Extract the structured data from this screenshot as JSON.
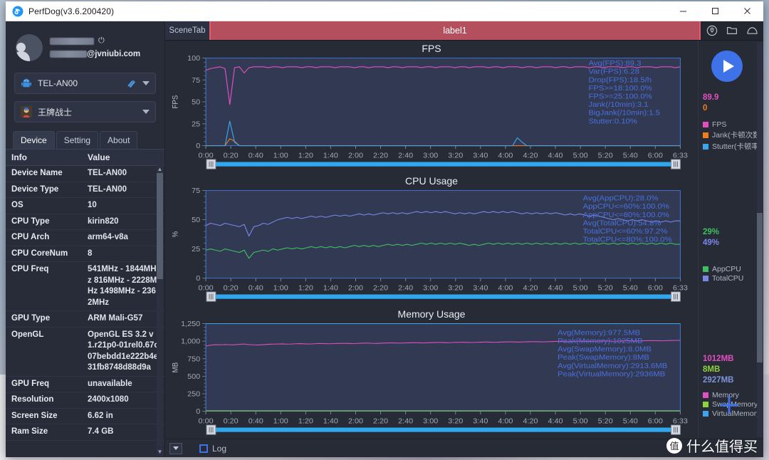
{
  "window": {
    "title": "PerfDog(v3.6.200420)",
    "logo_icon": "perfdog-logo-icon",
    "controls": [
      {
        "name": "minimize-button",
        "icon": "minimize-icon"
      },
      {
        "name": "maximize-button",
        "icon": "maximize-icon"
      },
      {
        "name": "close-button",
        "icon": "close-icon"
      }
    ]
  },
  "sidebar": {
    "account": {
      "name_redacted": true,
      "email": "@jvniubi.com",
      "power_icon": "power-icon",
      "avatar_icon": "avatar-icon"
    },
    "device_select": {
      "value": "TEL-AN00",
      "platform_icon": "android-icon",
      "usb_icon": "usb-link-icon",
      "caret_icon": "chevron-down-icon"
    },
    "app_select": {
      "value": "王牌战士",
      "app_icon": "game-app-icon",
      "caret_icon": "chevron-down-icon"
    },
    "tabs": [
      {
        "label": "Device",
        "active": true
      },
      {
        "label": "Setting",
        "active": false
      },
      {
        "label": "About",
        "active": false
      }
    ],
    "table": {
      "headers": [
        "Info",
        "Value"
      ],
      "rows": [
        [
          "Device Name",
          "TEL-AN00"
        ],
        [
          "Device Type",
          "TEL-AN00"
        ],
        [
          "OS",
          "10"
        ],
        [
          "CPU Type",
          "kirin820"
        ],
        [
          "CPU Arch",
          "arm64-v8a"
        ],
        [
          "CPU CoreNum",
          "8"
        ],
        [
          "CPU Freq",
          "541MHz - 1844MHz 816MHz - 2228MHz 1498MHz - 2362MHz"
        ],
        [
          "GPU Type",
          "ARM Mali-G57"
        ],
        [
          "OpenGL",
          "OpenGL ES 3.2 v1.r21p0-01rel0.67c07bebdd1e222b4e31fb8748d88d9a"
        ],
        [
          "GPU Freq",
          "unavailable"
        ],
        [
          "Resolution",
          "2400x1080"
        ],
        [
          "Screen Size",
          "6.62 in"
        ],
        [
          "Ram Size",
          "7.4 GB"
        ]
      ]
    }
  },
  "scene_bar": {
    "tab_label": "SceneTab",
    "label_strip": "label1",
    "icons": [
      {
        "name": "location-pin-icon"
      },
      {
        "name": "folder-icon"
      },
      {
        "name": "cloud-icon"
      }
    ]
  },
  "toolbar": {
    "play_button": "play-icon",
    "add_button": "plus-icon"
  },
  "bottom": {
    "collapse_icon": "chevron-down-icon",
    "log_label": "Log",
    "log_checked": false
  },
  "watermark": {
    "badge": "值",
    "text": "什么值得买"
  },
  "colors": {
    "fps": "#e24fc0",
    "jank": "#ef7d1a",
    "stutter": "#3da5f0",
    "appcpu": "#3fbf5f",
    "totalcpu": "#7a86e8",
    "memory": "#e24fc0",
    "swapmemory": "#8fd13f",
    "virtualmemory": "#3da5f0",
    "stat_text": "#4b6fe0",
    "accent": "#3d72e8",
    "scene_strip": "#b4505e"
  },
  "chart_data": [
    {
      "type": "line",
      "title": "FPS",
      "ylabel": "FPS",
      "xlabel": "",
      "ylim": [
        0,
        100
      ],
      "yticks": [
        0,
        25,
        50,
        75,
        100
      ],
      "xticks": [
        "0:00",
        "0:20",
        "0:40",
        "1:00",
        "1:20",
        "1:40",
        "2:00",
        "2:20",
        "2:40",
        "3:00",
        "3:20",
        "3:40",
        "4:00",
        "4:20",
        "4:40",
        "5:00",
        "5:20",
        "5:40",
        "6:00",
        "6:33"
      ],
      "grid": false,
      "legend_position": "right",
      "series": [
        {
          "name": "FPS",
          "color": "#e24fc0",
          "current": "89.9",
          "values": [
            86,
            88,
            89,
            90,
            88,
            47,
            89,
            90,
            83,
            89,
            90,
            90,
            90,
            89,
            90,
            90,
            89,
            90,
            90,
            90,
            89,
            90,
            90,
            89,
            90,
            90,
            90,
            89,
            90,
            90,
            90,
            89,
            90,
            90,
            89,
            90,
            90,
            90,
            89,
            90,
            90,
            89,
            90,
            90,
            90,
            89,
            90,
            90,
            89,
            90,
            90,
            90,
            89,
            90,
            90,
            89,
            90,
            90,
            90,
            89,
            90,
            90,
            89,
            90,
            90,
            90,
            89,
            90,
            90,
            89,
            90,
            90,
            90,
            89,
            90,
            90,
            89,
            90,
            90,
            90,
            89,
            90,
            90,
            89,
            90,
            90,
            90,
            89,
            90,
            90,
            89,
            90,
            90,
            90,
            89,
            90,
            90,
            90,
            89,
            90
          ]
        },
        {
          "name": "Jank(卡顿次数)",
          "color": "#ef7d1a",
          "current": "0",
          "values": [
            0,
            0,
            0,
            0,
            0,
            8,
            5,
            0,
            0,
            0,
            0,
            0,
            0,
            0,
            0,
            0,
            0,
            0,
            0,
            0,
            0,
            0,
            0,
            0,
            0,
            0,
            0,
            0,
            0,
            0,
            0,
            0,
            0,
            0,
            0,
            0,
            0,
            0,
            0,
            0,
            0,
            0,
            0,
            0,
            0,
            0,
            0,
            0,
            0,
            0,
            0,
            0,
            0,
            0,
            0,
            0,
            0,
            0,
            0,
            0,
            0,
            0,
            0,
            0,
            0,
            0,
            0,
            0,
            0,
            0,
            0,
            0,
            0,
            0,
            0,
            0,
            0,
            0,
            0,
            0,
            0,
            0,
            0,
            0,
            0,
            0,
            0,
            0,
            0,
            0,
            0,
            0,
            0,
            0,
            0,
            0,
            0,
            0,
            0,
            0
          ]
        },
        {
          "name": "Stutter(卡顿率)",
          "color": "#3da5f0",
          "current": "",
          "values": [
            0,
            0,
            0,
            0,
            0,
            28,
            4,
            0,
            0,
            0,
            0,
            0,
            0,
            0,
            0,
            0,
            0,
            0,
            0,
            0,
            0,
            0,
            0,
            0,
            0,
            0,
            0,
            0,
            0,
            0,
            0,
            0,
            0,
            0,
            0,
            0,
            0,
            0,
            0,
            0,
            0,
            0,
            0,
            0,
            0,
            0,
            0,
            0,
            0,
            0,
            0,
            0,
            0,
            0,
            0,
            0,
            0,
            0,
            0,
            0,
            0,
            0,
            0,
            0,
            0,
            9,
            4,
            0,
            0,
            0,
            0,
            0,
            0,
            0,
            0,
            0,
            0,
            0,
            0,
            0,
            0,
            0,
            0,
            0,
            0,
            0,
            0,
            0,
            0,
            0,
            0,
            0,
            0,
            0,
            0,
            0,
            0,
            0,
            0,
            0
          ]
        }
      ],
      "annotations": [
        "Avg(FPS):89.3",
        "Var(FPS):6.28",
        "Drop(FPS):18.5/h",
        "FPS>=18:100.0%",
        "FPS>=25:100.0%",
        "Jank(/10min):3.1",
        "BigJank(/10min):1.5",
        "Stutter:0.10%"
      ]
    },
    {
      "type": "line",
      "title": "CPU Usage",
      "ylabel": "%",
      "xlabel": "",
      "ylim": [
        0,
        75
      ],
      "yticks": [
        0,
        25,
        50,
        75
      ],
      "xticks": [
        "0:00",
        "0:20",
        "0:40",
        "1:00",
        "1:20",
        "1:40",
        "2:00",
        "2:20",
        "2:40",
        "3:00",
        "3:20",
        "3:40",
        "4:00",
        "4:20",
        "4:40",
        "5:00",
        "5:20",
        "5:40",
        "6:00",
        "6:33"
      ],
      "grid": false,
      "legend_position": "right",
      "series": [
        {
          "name": "AppCPU",
          "color": "#3fbf5f",
          "current": "29%",
          "values": [
            24,
            25,
            24,
            23,
            25,
            24,
            23,
            22,
            24,
            17,
            22,
            23,
            24,
            23,
            25,
            24,
            25,
            26,
            25,
            26,
            25,
            26,
            27,
            26,
            27,
            26,
            27,
            26,
            27,
            26,
            27,
            28,
            27,
            28,
            27,
            28,
            27,
            28,
            29,
            28,
            29,
            28,
            29,
            28,
            29,
            30,
            29,
            30,
            29,
            30,
            29,
            30,
            29,
            30,
            29,
            28,
            29,
            28,
            29,
            30,
            29,
            30,
            29,
            30,
            29,
            30,
            29,
            30,
            29,
            30,
            29,
            30,
            29,
            30,
            29,
            30,
            29,
            30,
            29,
            30,
            29,
            30,
            29,
            30,
            29,
            30,
            29,
            30,
            29,
            30,
            29,
            30,
            29,
            30,
            29,
            30,
            29,
            30,
            29,
            29
          ]
        },
        {
          "name": "TotalCPU",
          "color": "#7a86e8",
          "current": "49%",
          "values": [
            45,
            47,
            46,
            45,
            47,
            46,
            45,
            44,
            46,
            36,
            44,
            45,
            47,
            46,
            48,
            50,
            51,
            52,
            51,
            52,
            51,
            52,
            53,
            52,
            53,
            52,
            53,
            54,
            53,
            54,
            53,
            54,
            55,
            54,
            55,
            54,
            55,
            56,
            55,
            56,
            55,
            56,
            55,
            56,
            57,
            56,
            57,
            56,
            57,
            56,
            57,
            56,
            55,
            56,
            55,
            56,
            55,
            56,
            57,
            56,
            57,
            56,
            57,
            56,
            57,
            56,
            55,
            56,
            55,
            56,
            55,
            56,
            55,
            56,
            55,
            54,
            55,
            54,
            55,
            54,
            53,
            54,
            53,
            52,
            51,
            50,
            51,
            50,
            49,
            50,
            49,
            50,
            49,
            48,
            49,
            48,
            49,
            48,
            49,
            49
          ]
        }
      ],
      "annotations": [
        "Avg(AppCPU):28.0%",
        "AppCPU<=60%:100.0%",
        "AppCPU<=80%:100.0%",
        "Avg(TotalCPU):54.8%",
        "TotalCPU<=60%:97.2%",
        "TotalCPU<=80%:100.0%"
      ]
    },
    {
      "type": "line",
      "title": "Memory Usage",
      "ylabel": "MB",
      "xlabel": "",
      "ylim": [
        0,
        1250
      ],
      "yticks": [
        0,
        250,
        500,
        750,
        1000,
        1250
      ],
      "ytick_labels": [
        "0",
        "250",
        "500",
        "750",
        "1,000",
        "1,250"
      ],
      "xticks": [
        "0:00",
        "0:20",
        "0:40",
        "1:00",
        "1:20",
        "1:40",
        "2:00",
        "2:20",
        "2:40",
        "3:00",
        "3:20",
        "3:40",
        "4:00",
        "4:20",
        "4:40",
        "5:00",
        "5:20",
        "5:40",
        "6:00",
        "6:33"
      ],
      "grid": false,
      "legend_position": "right",
      "series": [
        {
          "name": "Memory",
          "color": "#e24fc0",
          "current": "1012MB",
          "values": [
            930,
            945,
            950,
            948,
            952,
            949,
            947,
            955,
            960,
            952,
            948,
            946,
            950,
            955,
            958,
            960,
            962,
            958,
            960,
            963,
            965,
            962,
            960,
            964,
            967,
            965,
            963,
            966,
            968,
            970,
            968,
            966,
            969,
            971,
            973,
            970,
            968,
            971,
            974,
            976,
            974,
            972,
            975,
            977,
            979,
            977,
            975,
            978,
            980,
            982,
            980,
            978,
            981,
            983,
            985,
            983,
            981,
            984,
            986,
            988,
            986,
            984,
            987,
            989,
            991,
            989,
            987,
            990,
            992,
            994,
            992,
            990,
            993,
            995,
            997,
            995,
            993,
            996,
            998,
            1000,
            998,
            996,
            999,
            1001,
            1003,
            1001,
            999,
            1002,
            1004,
            1006,
            1004,
            1002,
            1005,
            1007,
            1009,
            1007,
            1005,
            1008,
            1010,
            1012,
            1012
          ]
        },
        {
          "name": "SwapMemory",
          "color": "#8fd13f",
          "current": "8MB",
          "values": [
            8,
            8,
            8,
            8,
            8,
            8,
            8,
            8,
            8,
            8,
            8,
            8,
            8,
            8,
            8,
            8,
            8,
            8,
            8,
            8,
            8,
            8,
            8,
            8,
            8,
            8,
            8,
            8,
            8,
            8,
            8,
            8,
            8,
            8,
            8,
            8,
            8,
            8,
            8,
            8,
            8,
            8,
            8,
            8,
            8,
            8,
            8,
            8,
            8,
            8,
            8,
            8,
            8,
            8,
            8,
            8,
            8,
            8,
            8,
            8,
            8,
            8,
            8,
            8,
            8,
            8,
            8,
            8,
            8,
            8,
            8,
            8,
            8,
            8,
            8,
            8,
            8,
            8,
            8,
            8,
            8,
            8,
            8,
            8,
            8,
            8,
            8,
            8,
            8,
            8,
            8,
            8,
            8,
            8,
            8,
            8,
            8,
            8,
            8,
            8
          ]
        },
        {
          "name": "VirtualMemory",
          "color": "#3da5f0",
          "current": "2927MB",
          "values": [
            2870,
            2880,
            2885,
            2888,
            2890,
            2892,
            2893,
            2895,
            2896,
            2897,
            2898,
            2899,
            2900,
            2901,
            2902,
            2903,
            2904,
            2905,
            2906,
            2907,
            2908,
            2909,
            2910,
            2911,
            2912,
            2913,
            2913,
            2914,
            2914,
            2915,
            2915,
            2916,
            2916,
            2917,
            2917,
            2918,
            2918,
            2919,
            2919,
            2920,
            2920,
            2921,
            2921,
            2922,
            2922,
            2922,
            2923,
            2923,
            2923,
            2924,
            2924,
            2924,
            2925,
            2925,
            2925,
            2926,
            2926,
            2926,
            2926,
            2927,
            2927,
            2927,
            2927,
            2928,
            2928,
            2928,
            2928,
            2929,
            2929,
            2929,
            2929,
            2930,
            2930,
            2930,
            2930,
            2931,
            2931,
            2931,
            2931,
            2932,
            2932,
            2932,
            2932,
            2933,
            2933,
            2933,
            2933,
            2934,
            2934,
            2934,
            2934,
            2935,
            2935,
            2935,
            2935,
            2936,
            2936,
            2936,
            2927,
            2927
          ]
        }
      ],
      "annotations": [
        "Avg(Memory):977.5MB",
        "Peak(Memory):1025MB",
        "Avg(SwapMemory):8.0MB",
        "Peak(SwapMemory):8MB",
        "Avg(VirtualMemory):2913.6MB",
        "Peak(VirtualMemory):2936MB"
      ]
    }
  ]
}
